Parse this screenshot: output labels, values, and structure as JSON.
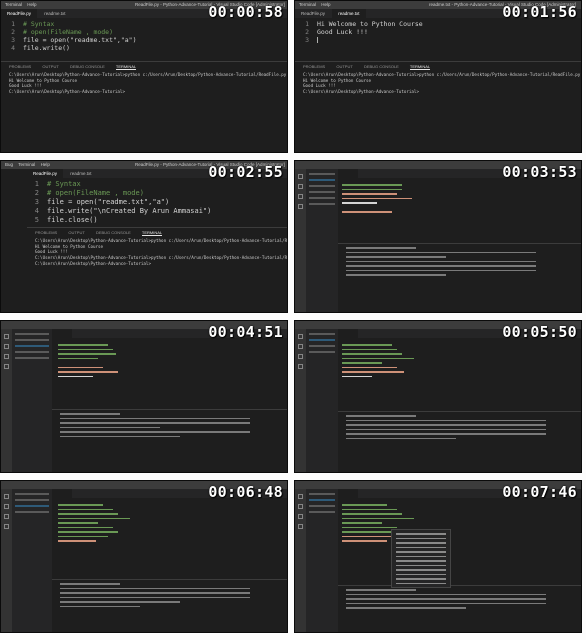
{
  "thumbnails": [
    {
      "timestamp": "00:00:58",
      "menu": [
        "Terminal",
        "Help"
      ],
      "window_title": "ReadFile.py - Python-Advance-Tutorial - Visual Studio Code [Administrator]",
      "tabs": [
        {
          "label": "ReadFile.py"
        },
        {
          "label": "readme.txt"
        }
      ],
      "code": [
        {
          "num": "1",
          "text": "# Syntax",
          "kind": "comment"
        },
        {
          "num": "2",
          "text": "# open(FileName , mode)",
          "kind": "comment"
        },
        {
          "num": "3",
          "text": "file = open(\"readme.txt\",\"a\")",
          "kind": "code"
        },
        {
          "num": "4",
          "text": "file.write()",
          "kind": "code"
        }
      ],
      "panel_tabs": [
        "PROBLEMS",
        "OUTPUT",
        "DEBUG CONSOLE",
        "TERMINAL"
      ],
      "terminal": [
        "C:\\Users\\Arun\\Desktop\\Python-Advance-Tutorial>python c:/Users/Arun/Desktop/Python-Advance-Tutorial/ReadFile.py",
        "Hi Welcome to Python Course",
        "Good Luck !!!",
        "",
        "C:\\Users\\Arun\\Desktop\\Python-Advance-Tutorial>"
      ]
    },
    {
      "timestamp": "00:01:56",
      "menu": [
        "Terminal",
        "Help"
      ],
      "window_title": "readme.txt - Python-Advance-Tutorial - Visual Studio Code [Administrator]",
      "tabs": [
        {
          "label": "ReadFile.py"
        },
        {
          "label": "readme.txt"
        }
      ],
      "code": [
        {
          "num": "1",
          "text": "Hi Welcome to Python Course",
          "kind": "plain"
        },
        {
          "num": "2",
          "text": "Good Luck !!!",
          "kind": "plain"
        },
        {
          "num": "3",
          "text": "",
          "kind": "plain"
        }
      ],
      "panel_tabs": [
        "PROBLEMS",
        "OUTPUT",
        "DEBUG CONSOLE",
        "TERMINAL"
      ],
      "terminal": [
        "C:\\Users\\Arun\\Desktop\\Python-Advance-Tutorial>python c:/Users/Arun/Desktop/Python-Advance-Tutorial/ReadFile.py",
        "Hi Welcome to Python Course",
        "Good Luck !!!",
        "",
        "C:\\Users\\Arun\\Desktop\\Python-Advance-Tutorial>"
      ]
    },
    {
      "timestamp": "00:02:55",
      "menu": [
        "Bug",
        "Terminal",
        "Help"
      ],
      "window_title": "ReadFile.py - Python-Advance-Tutorial - Visual Studio Code [Administrator]",
      "tabs": [
        {
          "label": "ReadFile.py"
        },
        {
          "label": "readme.txt"
        }
      ],
      "code": [
        {
          "num": "1",
          "text": "# Syntax",
          "kind": "comment"
        },
        {
          "num": "2",
          "text": "# open(FileName , mode)",
          "kind": "comment"
        },
        {
          "num": "3",
          "text": "file = open(\"readme.txt\",\"a\")",
          "kind": "code"
        },
        {
          "num": "4",
          "text": "file.write(\"\\nCreated By Arun Ammasai\")",
          "kind": "code"
        },
        {
          "num": "5",
          "text": "file.close()",
          "kind": "code"
        }
      ],
      "panel_tabs": [
        "PROBLEMS",
        "OUTPUT",
        "DEBUG CONSOLE",
        "TERMINAL"
      ],
      "terminal": [
        "C:\\Users\\Arun\\Desktop\\Python-Advance-Tutorial>python c:/Users/Arun/Desktop/Python-Advance-Tutorial/ReadFile.py",
        "Hi Welcome to Python Course",
        "Good Luck !!!",
        "",
        "C:\\Users\\Arun\\Desktop\\Python-Advance-Tutorial>python c:/Users/Arun/Desktop/Python-Advance-Tutorial/ReadFile.py",
        "",
        "C:\\Users\\Arun\\Desktop\\Python-Advance-Tutorial>"
      ]
    },
    {
      "timestamp": "00:03:53"
    },
    {
      "timestamp": "00:04:51"
    },
    {
      "timestamp": "00:05:50"
    },
    {
      "timestamp": "00:06:48"
    },
    {
      "timestamp": "00:07:46"
    }
  ],
  "theme": {
    "editor_bg": "#1e1e1e",
    "sidebar_bg": "#252526",
    "titlebar_bg": "#3c3c3c",
    "comment": "#6a9955",
    "string": "#ce9178",
    "text": "#d4d4d4"
  }
}
